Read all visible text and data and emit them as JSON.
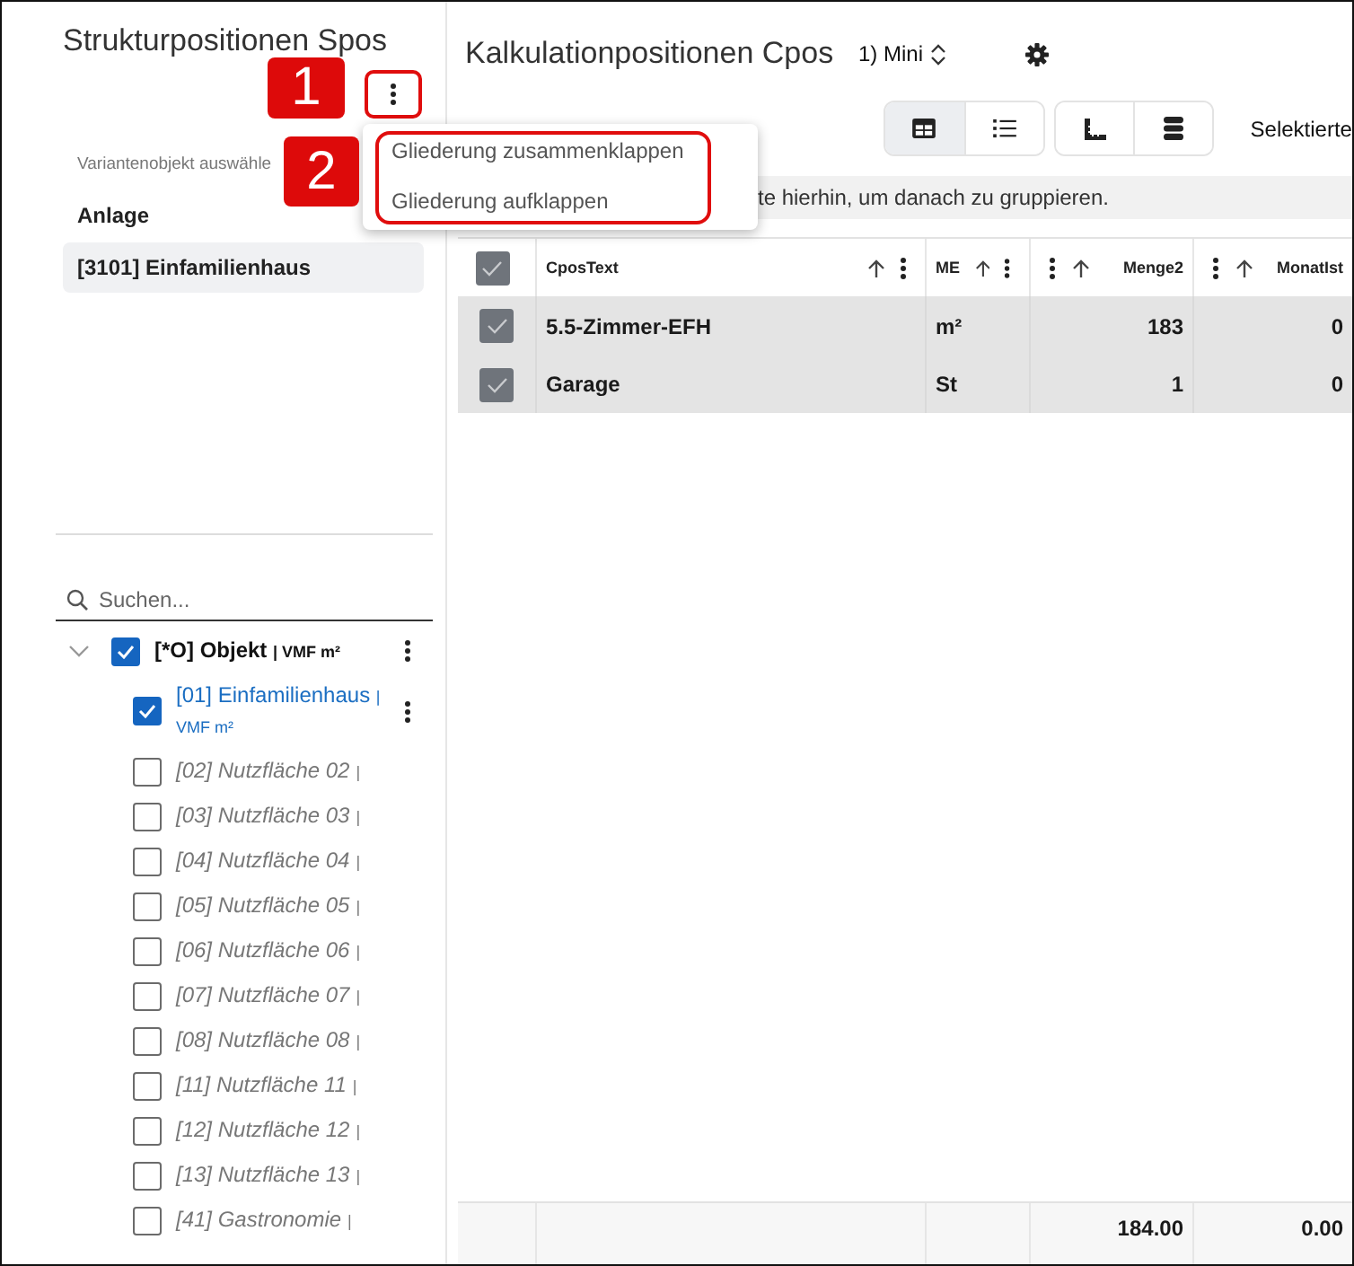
{
  "left_panel": {
    "title": "Strukturpositionen Spos",
    "menu_button": {
      "highlighted": true
    },
    "hint": "Variantenobjekt auswähle",
    "section_label": "Anlage",
    "selected_object": "[3101] Einfamilienhaus",
    "search": {
      "placeholder": "Suchen..."
    },
    "tree": [
      {
        "label": "[*O] Objekt",
        "unit": "| VMF m²",
        "expanded": true,
        "checked": true,
        "selected": false,
        "inactive": false,
        "menu_button": true,
        "children": [
          {
            "label": "[01] Einfamilienhaus",
            "unit": "| VMF m²",
            "checked": true,
            "selected": true,
            "inactive": false,
            "menu_button": true
          },
          {
            "label": "[02] Nutzfläche 02",
            "unit": "|",
            "checked": false,
            "selected": false,
            "inactive": true,
            "menu_button": false
          },
          {
            "label": "[03] Nutzfläche 03",
            "unit": "|",
            "checked": false,
            "selected": false,
            "inactive": true,
            "menu_button": false
          },
          {
            "label": "[04] Nutzfläche 04",
            "unit": "|",
            "checked": false,
            "selected": false,
            "inactive": true,
            "menu_button": false
          },
          {
            "label": "[05] Nutzfläche 05",
            "unit": "|",
            "checked": false,
            "selected": false,
            "inactive": true,
            "menu_button": false
          },
          {
            "label": "[06] Nutzfläche 06",
            "unit": "|",
            "checked": false,
            "selected": false,
            "inactive": true,
            "menu_button": false
          },
          {
            "label": "[07] Nutzfläche 07",
            "unit": "|",
            "checked": false,
            "selected": false,
            "inactive": true,
            "menu_button": false
          },
          {
            "label": "[08] Nutzfläche 08",
            "unit": "|",
            "checked": false,
            "selected": false,
            "inactive": true,
            "menu_button": false
          },
          {
            "label": "[11] Nutzfläche 11",
            "unit": "|",
            "checked": false,
            "selected": false,
            "inactive": true,
            "menu_button": false
          },
          {
            "label": "[12] Nutzfläche 12",
            "unit": "|",
            "checked": false,
            "selected": false,
            "inactive": true,
            "menu_button": false
          },
          {
            "label": "[13] Nutzfläche 13",
            "unit": "|",
            "checked": false,
            "selected": false,
            "inactive": true,
            "menu_button": false
          },
          {
            "label": "[41] Gastronomie",
            "unit": "|",
            "checked": false,
            "selected": false,
            "inactive": true,
            "menu_button": false
          }
        ]
      }
    ]
  },
  "dropdown_menu": {
    "highlighted": true,
    "items": [
      {
        "label": "Gliederung zusammenklappen"
      },
      {
        "label": "Gliederung aufklappen"
      }
    ]
  },
  "callouts": [
    {
      "number": "1"
    },
    {
      "number": "2"
    }
  ],
  "right_panel": {
    "title": "Kalkulationpositionen Cpos",
    "layout_select": "1) Mini",
    "view_buttons": [
      {
        "selected": true
      },
      {
        "selected": false
      }
    ],
    "selection_label": "Selektierte",
    "group_hint": "te hierhin, um danach zu gruppieren.",
    "table": {
      "header_checked": true,
      "columns": [
        {
          "label": "CposText",
          "kind": "text"
        },
        {
          "label": "ME",
          "kind": "text"
        },
        {
          "label": "Menge2",
          "kind": "number"
        },
        {
          "label": "MonatIst",
          "kind": "number"
        }
      ],
      "rows": [
        {
          "selected": true,
          "checked": true,
          "cells": [
            "5.5-Zimmer-EFH",
            "m²",
            "183",
            "0"
          ]
        },
        {
          "selected": true,
          "checked": true,
          "cells": [
            "Garage",
            "St",
            "1",
            "0"
          ]
        }
      ],
      "footer_rows": [
        {
          "cells": [
            null,
            null,
            "184.00",
            "0.00"
          ]
        }
      ]
    }
  }
}
